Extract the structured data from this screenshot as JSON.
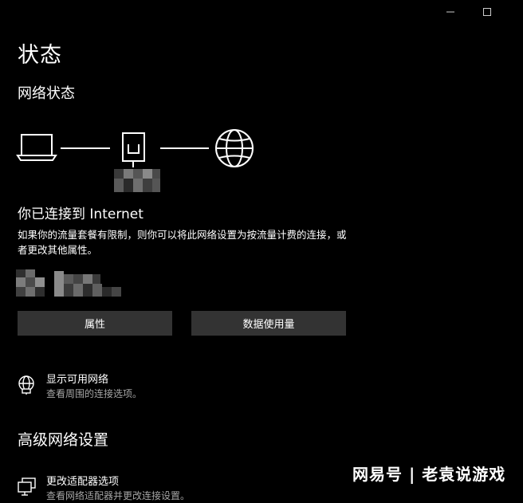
{
  "window": {
    "minimize_icon": "minimize-icon",
    "maximize_icon": "maximize-icon"
  },
  "page": {
    "title": "状态",
    "network_status_heading": "网络状态"
  },
  "diagram": {
    "icons": [
      "laptop-icon",
      "router-icon",
      "globe-icon"
    ]
  },
  "connection": {
    "title": "你已连接到 Internet",
    "description": "如果你的流量套餐有限制，则你可以将此网络设置为按流量计费的连接，或者更改其他属性。"
  },
  "buttons": {
    "properties": "属性",
    "data_usage": "数据使用量"
  },
  "links": {
    "show_networks": {
      "title": "显示可用网络",
      "subtitle": "查看周围的连接选项。",
      "icon": "available-networks-icon"
    },
    "change_adapter": {
      "title": "更改适配器选项",
      "subtitle": "查看网络适配器并更改连接设置。",
      "icon": "adapter-icon"
    }
  },
  "advanced": {
    "heading": "高级网络设置"
  },
  "watermark": {
    "text": "网易号 | 老袁说游戏"
  },
  "colors": {
    "background": "#000000",
    "button_bg": "#333333",
    "text": "#ffffff",
    "secondary_text": "#a6a6a6"
  }
}
